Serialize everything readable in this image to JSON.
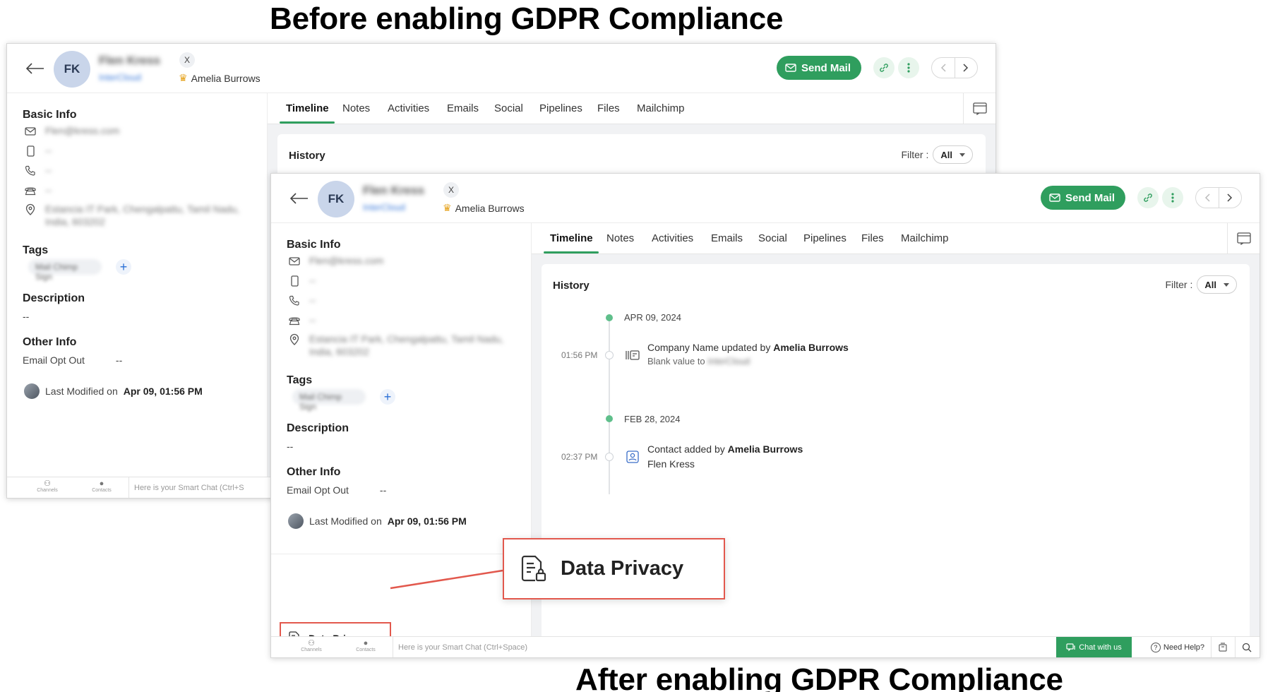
{
  "captions": {
    "before": "Before enabling GDPR Compliance",
    "after": "After enabling GDPR Compliance"
  },
  "record": {
    "initials": "FK",
    "name": "Flen Kress",
    "company": "InterCloud",
    "social_badge": "X",
    "owner": "Amelia Burrows"
  },
  "toolbar": {
    "send_mail": "Send Mail"
  },
  "basic_info": {
    "title": "Basic Info",
    "email": "Flen@kress.com",
    "mobile": "--",
    "phone": "--",
    "landline": "--",
    "address_line1": "Estancia IT Park, Chengalpattu, Tamil Nadu,",
    "address_line2": "India, 603202"
  },
  "tags": {
    "title": "Tags",
    "tag": "Mail Chimp Sign",
    "add": "+"
  },
  "description": {
    "title": "Description",
    "value": "--"
  },
  "other_info": {
    "title": "Other Info",
    "email_opt_out_label": "Email Opt Out",
    "email_opt_out_value": "--"
  },
  "last_modified": {
    "prefix": "Last Modified on",
    "date": "Apr 09, 01:56 PM"
  },
  "data_privacy": {
    "label": "Data Privacy"
  },
  "tabs": [
    {
      "label": "Timeline",
      "active": true
    },
    {
      "label": "Notes",
      "active": false
    },
    {
      "label": "Activities",
      "active": false
    },
    {
      "label": "Emails",
      "active": false
    },
    {
      "label": "Social",
      "active": false
    },
    {
      "label": "Pipelines",
      "active": false
    },
    {
      "label": "Files",
      "active": false
    },
    {
      "label": "Mailchimp",
      "active": false
    }
  ],
  "history": {
    "title": "History",
    "filter_label": "Filter :",
    "filter_value": "All",
    "entries": [
      {
        "date": "APR 09, 2024",
        "time": "01:56 PM",
        "text": "Company Name updated by",
        "actor": "Amelia Burrows",
        "sub_prefix": "Blank value to",
        "sub_value": "InterCloud"
      },
      {
        "date": "FEB 28, 2024",
        "time": "02:37 PM",
        "text": "Contact added by",
        "actor": "Amelia Burrows",
        "sub_value": "Flen Kress"
      }
    ]
  },
  "bottom_bar": {
    "channels": "Channels",
    "contacts": "Contacts",
    "smart_chat_before": "Here is your Smart Chat (Ctrl+S",
    "smart_chat": "Here is your Smart Chat (Ctrl+Space)",
    "chat_with_us": "Chat with us",
    "need_help": "Need Help?"
  },
  "colors": {
    "accent_green": "#2f9e5e",
    "highlight_red": "#e2584d",
    "avatar_bg": "#c9d5ea"
  }
}
